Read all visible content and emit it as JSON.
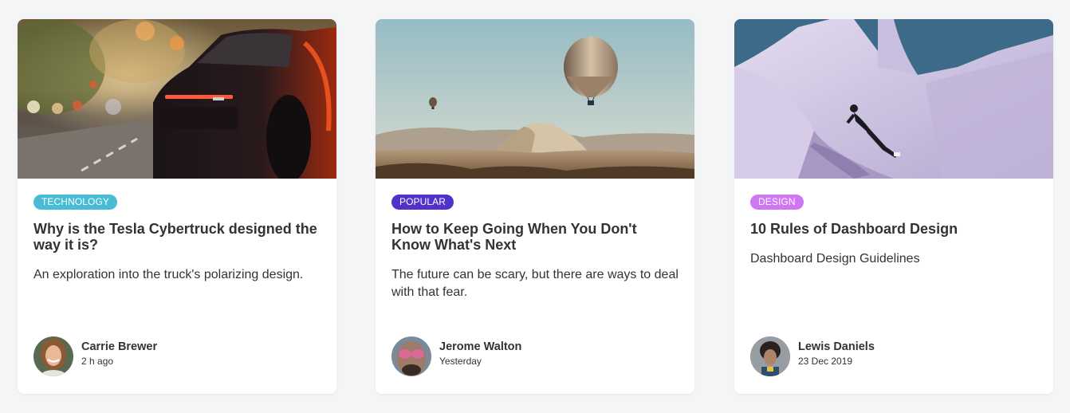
{
  "cards": [
    {
      "tag": "Technology",
      "tag_color": "#47bcd4",
      "image": "sports-car-night-street",
      "title": "Why is the Tesla Cybertruck designed the way it is?",
      "description": "An exploration into the truck's polarizing design.",
      "author": {
        "name": "Carrie Brewer",
        "time": "2 h ago",
        "avatar": "woman-smiling-avatar"
      }
    },
    {
      "tag": "Popular",
      "tag_color": "#5031c9",
      "image": "hot-air-balloons-desert",
      "title": "How to Keep Going When You Don't Know What's Next",
      "description": "The future can be scary, but there are ways to deal with that fear.",
      "author": {
        "name": "Jerome Walton",
        "time": "Yesterday",
        "avatar": "man-sunglasses-avatar"
      }
    },
    {
      "tag": "Design",
      "tag_color": "#cf77f3",
      "image": "person-jumping-white-structure",
      "title": "10 Rules of Dashboard Design",
      "description": "Dashboard Design Guidelines",
      "author": {
        "name": "Lewis Daniels",
        "time": "23 Dec 2019",
        "avatar": "man-curly-hair-avatar"
      }
    }
  ]
}
